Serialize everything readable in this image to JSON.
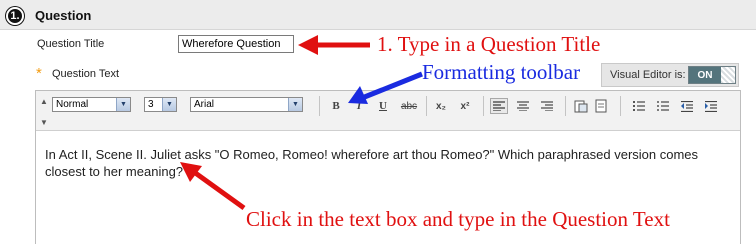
{
  "section": {
    "number": "1.",
    "title": "Question"
  },
  "form": {
    "question_title_label": "Question Title",
    "question_title_value": "Wherefore Question",
    "question_text_label": "Question Text",
    "required_mark": "*"
  },
  "visual_editor": {
    "label": "Visual Editor is:",
    "state": "ON"
  },
  "toolbar": {
    "format_select": "Normal",
    "size_select": "3",
    "font_select": "Arial",
    "bold": "B",
    "italic": "I",
    "underline": "U",
    "strikethrough": "abc",
    "subscript": "x₂",
    "superscript": "x²"
  },
  "editor": {
    "content": "In Act II, Scene II. Juliet asks \"O Romeo, Romeo! wherefore art thou Romeo?\" Which paraphrased version comes closest to her meaning?"
  },
  "annotations": {
    "title_hint": "1. Type in a Question Title",
    "toolbar_hint": "Formatting toolbar",
    "text_hint": "Click in the text box and type in the Question Text"
  },
  "colors": {
    "annotation_red": "#e01010",
    "annotation_blue": "#1a2be0",
    "toggle_on": "#54747c",
    "required_star": "#f39c12"
  }
}
